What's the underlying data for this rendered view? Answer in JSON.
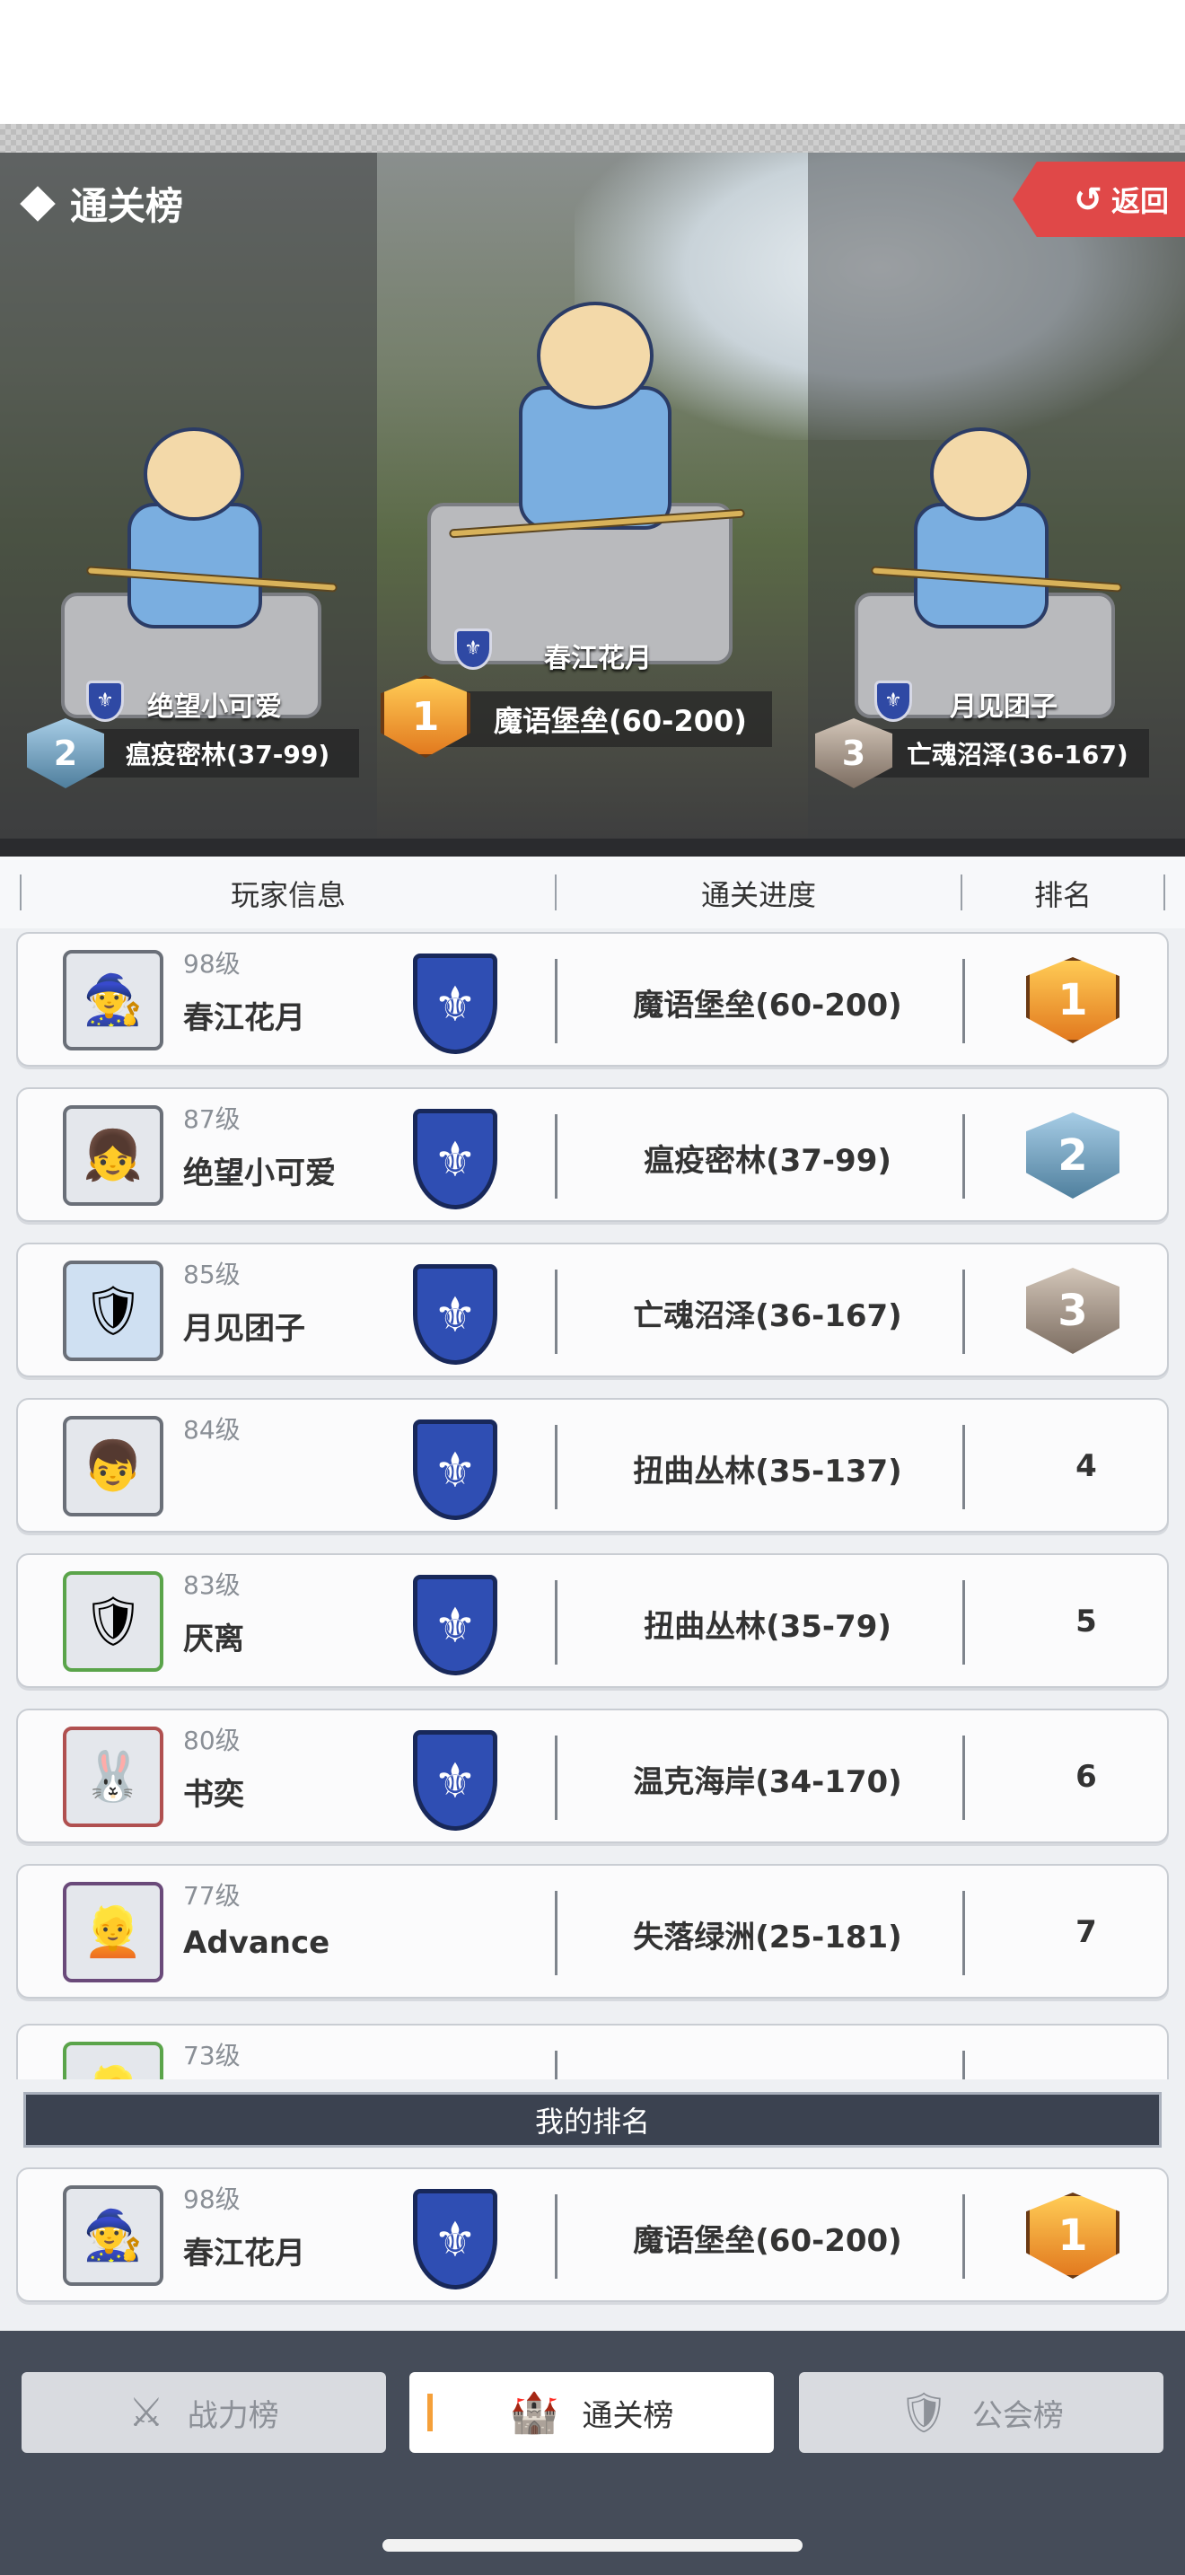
{
  "header": {
    "title": "通关榜",
    "back_label": "返回"
  },
  "podium": {
    "first": {
      "name": "春江花月",
      "progress": "魔语堡垒(60-200)",
      "rank": "1"
    },
    "second": {
      "name": "绝望小可爱",
      "progress": "瘟疫密林(37-99)",
      "rank": "2"
    },
    "third": {
      "name": "月见团子",
      "progress": "亡魂沼泽(36-167)",
      "rank": "3"
    }
  },
  "table": {
    "columns": [
      "玩家信息",
      "通关进度",
      "排名"
    ],
    "rows": [
      {
        "level": "98级",
        "name": "春江花月",
        "progress": "魔语堡垒(60-200)",
        "rank": "1"
      },
      {
        "level": "87级",
        "name": "绝望小可爱",
        "progress": "瘟疫密林(37-99)",
        "rank": "2"
      },
      {
        "level": "85级",
        "name": "月见团子",
        "progress": "亡魂沼泽(36-167)",
        "rank": "3"
      },
      {
        "level": "84级",
        "name": "",
        "progress": "扭曲丛林(35-137)",
        "rank": "4"
      },
      {
        "level": "83级",
        "name": "厌离",
        "progress": "扭曲丛林(35-79)",
        "rank": "5"
      },
      {
        "level": "80级",
        "name": "书奕",
        "progress": "温克海岸(34-170)",
        "rank": "6"
      },
      {
        "level": "77级",
        "name": "Advance",
        "progress": "失落绿洲(25-181)",
        "rank": "7"
      },
      {
        "level": "73级",
        "name": "",
        "progress": "",
        "rank": ""
      }
    ]
  },
  "my_rank": {
    "label": "我的排名",
    "level": "98级",
    "name": "春江花月",
    "progress": "魔语堡垒(60-200)",
    "rank": "1"
  },
  "tabs": [
    {
      "label": "战力榜",
      "icon": "swords-icon",
      "active": false
    },
    {
      "label": "通关榜",
      "icon": "castle-icon",
      "active": true
    },
    {
      "label": "公会榜",
      "icon": "guild-icon",
      "active": false
    }
  ],
  "colors": {
    "accent": "#f5a03a",
    "back_button": "#e04848",
    "guild_shield": "#2f4eb3",
    "bottom_bar": "#454c59"
  }
}
